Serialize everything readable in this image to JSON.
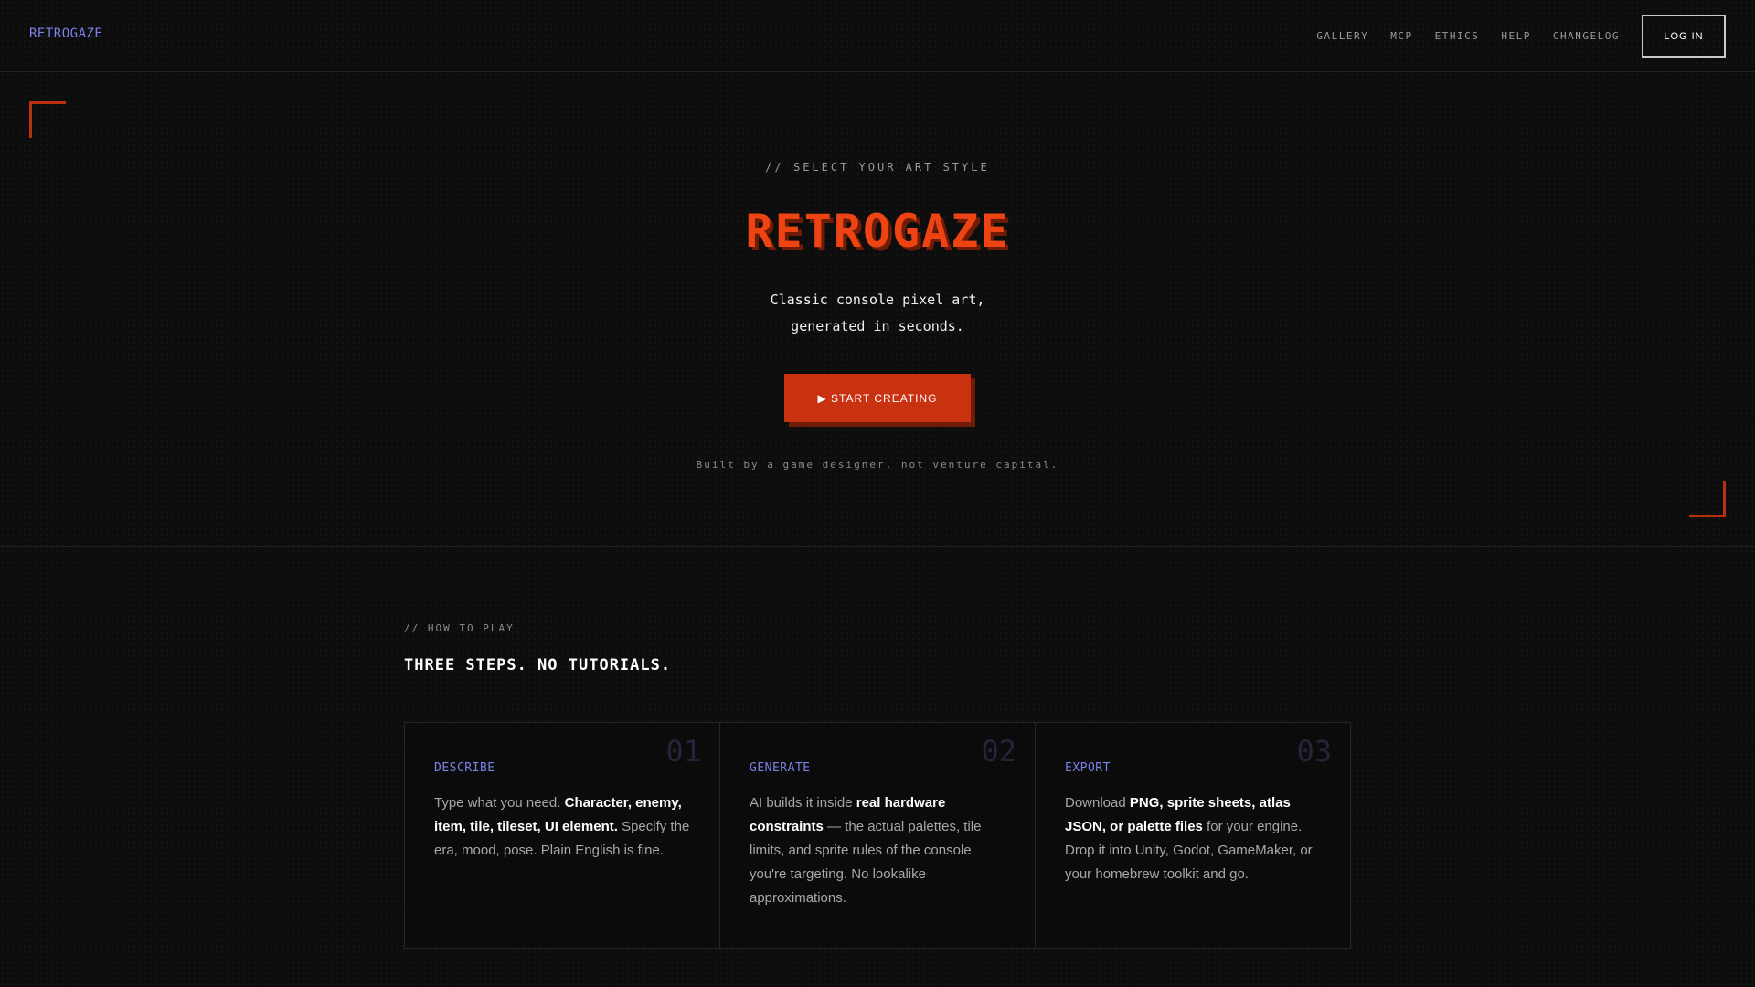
{
  "header": {
    "brand": "RETROGAZE",
    "nav": [
      "GALLERY",
      "MCP",
      "ETHICS",
      "HELP",
      "CHANGELOG"
    ],
    "login": "LOG IN"
  },
  "hero": {
    "eyebrow": "// SELECT YOUR ART STYLE",
    "title": "RETROGAZE",
    "tagline_line1": "Classic console pixel art,",
    "tagline_line2": "generated in seconds.",
    "cta": "▶ START CREATING",
    "built_by": "Built by a game designer, not venture capital."
  },
  "how": {
    "eyebrow": "// HOW TO PLAY",
    "title": "THREE STEPS. NO TUTORIALS.",
    "steps": [
      {
        "num": "01",
        "label": "DESCRIBE",
        "t1": "Type what you need. ",
        "b1": "Character, enemy, item, tile, tileset, UI element.",
        "t2": " Specify the era, mood, pose. Plain English is fine."
      },
      {
        "num": "02",
        "label": "GENERATE",
        "t1": "AI builds it inside ",
        "b1": "real hardware constraints",
        "t2": " — the actual palettes, tile limits, and sprite rules of the console you're targeting. No lookalike approximations."
      },
      {
        "num": "03",
        "label": "EXPORT",
        "t1": "Download ",
        "b1": "PNG, sprite sheets, atlas JSON, or palette files",
        "t2": " for your engine. Drop it into Unity, Godot, GameMaker, or your homebrew toolkit and go."
      }
    ]
  },
  "colors": {
    "accent": "#ee4414",
    "accent_dark": "#6e1c07",
    "brand_blue": "#7b82e8",
    "background": "#0d0d0d"
  }
}
